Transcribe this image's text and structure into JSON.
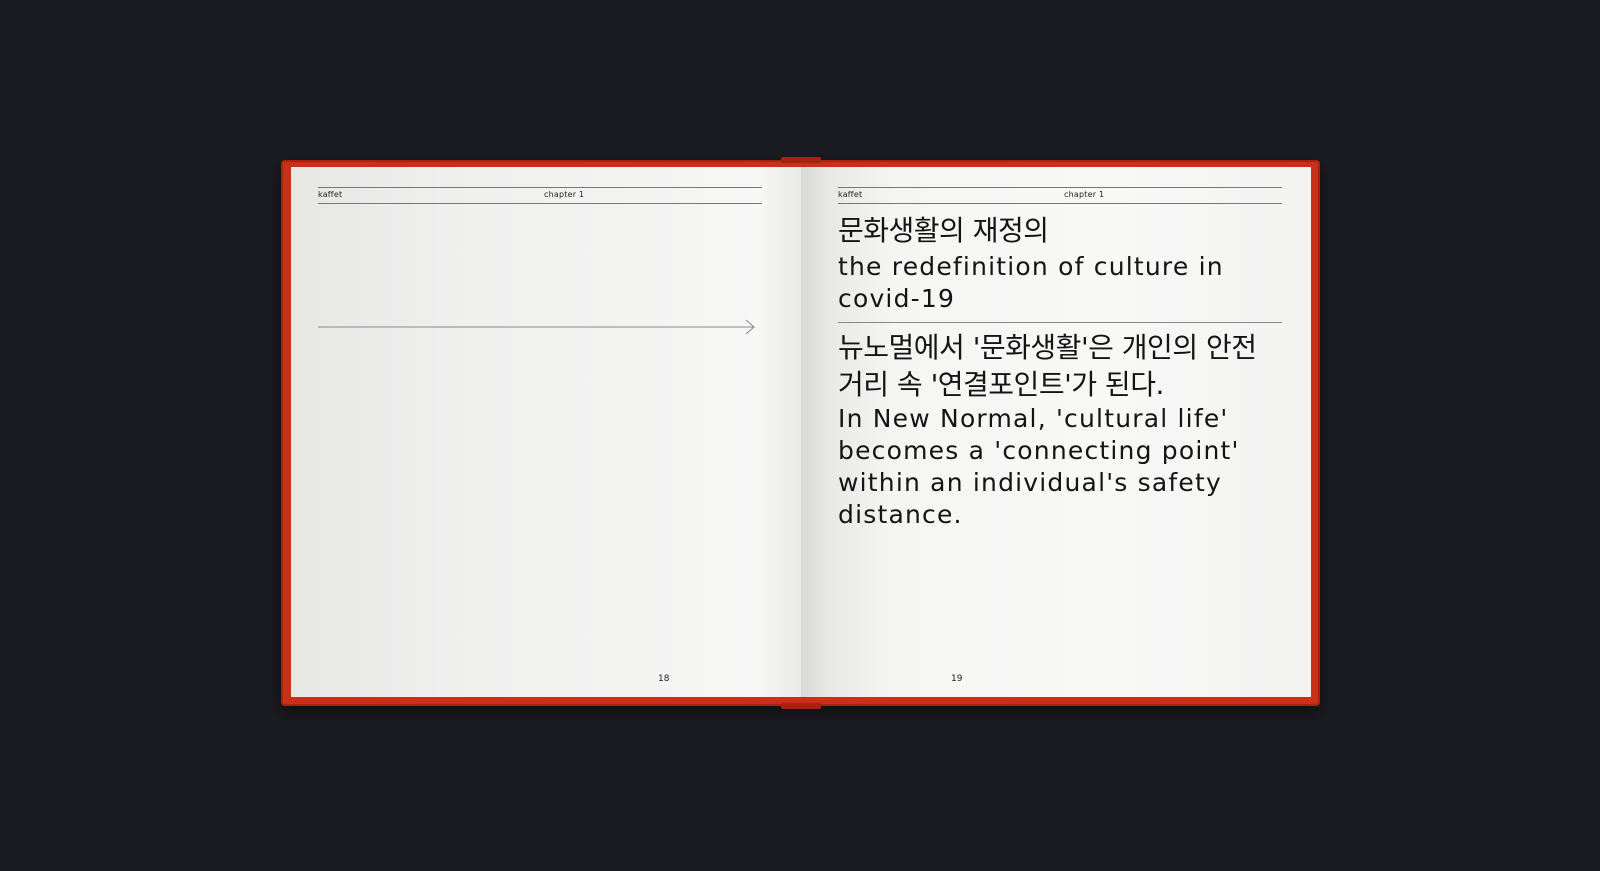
{
  "left_page": {
    "brand": "kaffet",
    "chapter": "chapter 1",
    "page_number": "18"
  },
  "right_page": {
    "brand": "kaffet",
    "chapter": "chapter 1",
    "page_number": "19",
    "title_ko": "문화생활의 재정의",
    "title_en": "the redefinition of culture in covid-19",
    "body_ko": "뉴노멀에서 '문화생활'은 개인의 안전 거리 속 '연결포인트'가 된다.",
    "body_en": "In New Normal, 'cultural life' becomes a 'connecting point' within an individual's safety distance."
  },
  "colors": {
    "background": "#1b1b22",
    "cover": "#c8301a",
    "paper": "#f4f4f3",
    "ink": "#141414"
  }
}
